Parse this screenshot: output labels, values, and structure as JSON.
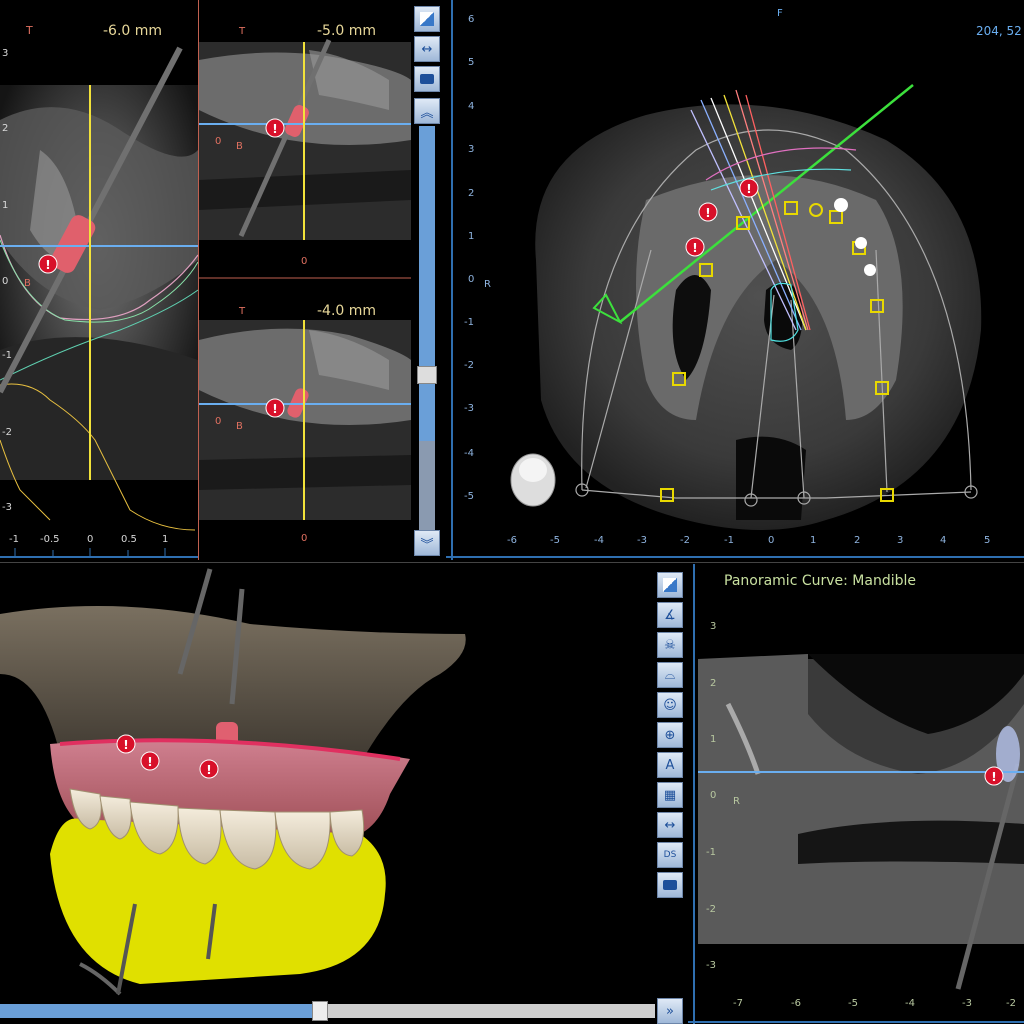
{
  "slice_panels": {
    "left": {
      "orientation": "T",
      "offset": "-6.0 mm"
    },
    "top": {
      "orientation": "T",
      "offset": "-5.0 mm",
      "zero": "0",
      "side": "B",
      "bottom_zero": "0"
    },
    "bottom": {
      "orientation": "T",
      "offset": "-4.0 mm",
      "zero": "0",
      "side": "B",
      "bottom_zero": "0"
    },
    "left_side": "B"
  },
  "left_axis": {
    "y_ticks": [
      "3",
      "2",
      "1",
      "0",
      "-1",
      "-2",
      "-3"
    ],
    "x_ticks": [
      "-1",
      "-0.5",
      "0",
      "0.5",
      "1"
    ]
  },
  "axial": {
    "top_marker": "F",
    "right_marker": "R",
    "coord_readout": "204, 52",
    "y_ticks": [
      "6",
      "5",
      "4",
      "3",
      "2",
      "1",
      "0",
      "-1",
      "-2",
      "-3",
      "-4",
      "-5"
    ],
    "x_ticks": [
      "-6",
      "-5",
      "-4",
      "-3",
      "-2",
      "-1",
      "0",
      "1",
      "2",
      "3",
      "4",
      "5"
    ]
  },
  "panoramic": {
    "title": "Panoramic Curve: Mandible",
    "side_marker": "R",
    "y_ticks": [
      "3",
      "2",
      "1",
      "0",
      "-1",
      "-2",
      "-3"
    ],
    "x_ticks": [
      "-7",
      "-6",
      "-5",
      "-4",
      "-3",
      "-2"
    ]
  },
  "toolbar_top": {
    "items": [
      "select-tool",
      "measure-distance",
      "screenshot",
      "scroll-up",
      "scroll-down"
    ]
  },
  "toolbar_right": {
    "items": [
      "select-tool",
      "angle-tool",
      "skull-view",
      "arch-view",
      "face-view",
      "center-view",
      "annotation-tool",
      "grid-view",
      "measure-distance",
      "ds-tool",
      "screenshot"
    ],
    "ds_label": "DS",
    "annotation_label": "A"
  },
  "scroll_3d": {
    "position": 0.48,
    "next": "»"
  },
  "vscroll": {
    "position": 0.78
  },
  "colors": {
    "crosshair": "#f2e23a",
    "guide": "#6aaef0",
    "implant": "#e06070",
    "warning": "#d8102a",
    "ruler": "#2f6fb0",
    "marker": "#e8d800",
    "arch": "#3ce03c"
  }
}
